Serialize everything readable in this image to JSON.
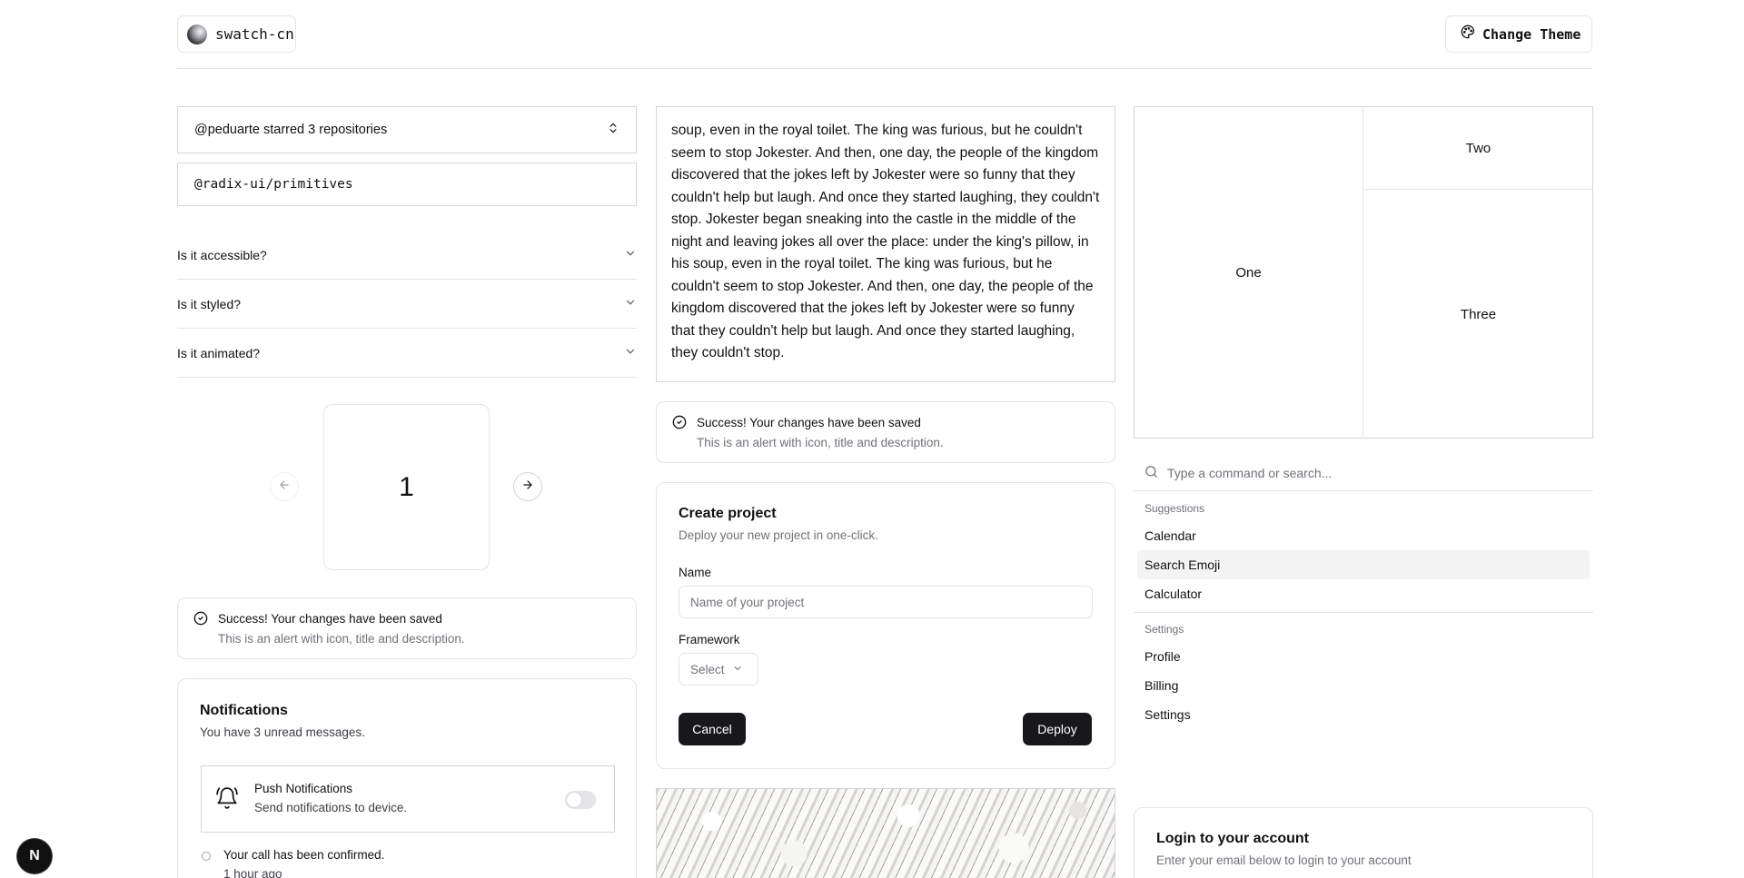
{
  "header": {
    "logo_text": "swatch-cn",
    "theme_button": "Change Theme"
  },
  "collapsible": {
    "title": "@peduarte starred 3 repositories",
    "repo": "@radix-ui/primitives"
  },
  "accordion": {
    "items": [
      {
        "label": "Is it accessible?"
      },
      {
        "label": "Is it styled?"
      },
      {
        "label": "Is it animated?"
      }
    ]
  },
  "carousel": {
    "current": "1"
  },
  "alert": {
    "title": "Success! Your changes have been saved",
    "description": "This is an alert with icon, title and description."
  },
  "notifications": {
    "title": "Notifications",
    "subtitle": "You have 3 unread messages.",
    "push_title": "Push Notifications",
    "push_desc": "Send notifications to device.",
    "push_enabled": false,
    "item_title": "Your call has been confirmed.",
    "item_time": "1 hour ago"
  },
  "scroll_area": {
    "text": "soup, even in the royal toilet. The king was furious, but he couldn't seem to stop Jokester. And then, one day, the people of the kingdom discovered that the jokes left by Jokester were so funny that they couldn't help but laugh. And once they started laughing, they couldn't stop. Jokester began sneaking into the castle in the middle of the night and leaving jokes all over the place: under the king's pillow, in his soup, even in the royal toilet. The king was furious, but he couldn't seem to stop Jokester. And then, one day, the people of the kingdom discovered that the jokes left by Jokester were so funny that they couldn't help but laugh. And once they started laughing, they couldn't stop."
  },
  "create_project": {
    "title": "Create project",
    "description": "Deploy your new project in one-click.",
    "name_label": "Name",
    "name_placeholder": "Name of your project",
    "framework_label": "Framework",
    "framework_value": "Select",
    "cancel": "Cancel",
    "deploy": "Deploy"
  },
  "resizable": {
    "one": "One",
    "two": "Two",
    "three": "Three"
  },
  "command": {
    "placeholder": "Type a command or search...",
    "groups": [
      {
        "label": "Suggestions",
        "items": [
          "Calendar",
          "Search Emoji",
          "Calculator"
        ]
      },
      {
        "label": "Settings",
        "items": [
          "Profile",
          "Billing",
          "Settings"
        ]
      }
    ],
    "active_item": "Search Emoji"
  },
  "login": {
    "title": "Login to your account",
    "description": "Enter your email below to login to your account"
  },
  "badge": {
    "letter": "N"
  }
}
